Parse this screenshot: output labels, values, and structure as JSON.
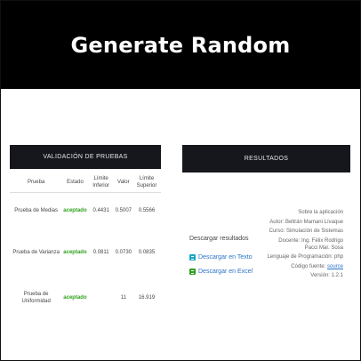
{
  "banner": {
    "title": "Generate Random"
  },
  "validation": {
    "title": "VALIDACIÓN DE PRUEBAS",
    "columns": [
      "Prueba",
      "Estado",
      "Límite Inferior",
      "Valor",
      "Límite Superior"
    ],
    "rows": [
      {
        "prueba": "Prueba de Medias",
        "estado": "aceptado",
        "inferior": "0.4431",
        "valor": "0.5007",
        "superior": "0.5566"
      },
      {
        "prueba": "Prueba de Varianza",
        "estado": "aceptado",
        "inferior": "0.0811",
        "valor": "0.0730",
        "superior": "0.0835"
      },
      {
        "prueba": "Prueba de Uniformidad",
        "estado": "aceptado",
        "inferior": "",
        "valor": "11",
        "superior": "16.919"
      }
    ]
  },
  "results": {
    "title": "RESULTADOS",
    "download_label": "Descargar resultados",
    "download_text": "Descargar en Texto",
    "download_excel": "Descargar en Excel"
  },
  "about": {
    "title": "Sobre la aplicación",
    "author": "Autor: Beltrán Mamani Lívaque",
    "course": "Curso: Simulación de Sistemas",
    "teacher": "Docente: Ing. Félix Rodrigo Pacci Mar. Sosa",
    "language": "Lenguaje de Programación: php",
    "source_prefix": "Código fuente: ",
    "source_link": "source",
    "version": "Versión: 1.2.1"
  },
  "colors": {
    "banner": "#000000",
    "header": "#15171d",
    "accepted": "#2fa01c",
    "link": "#2b73c9"
  }
}
